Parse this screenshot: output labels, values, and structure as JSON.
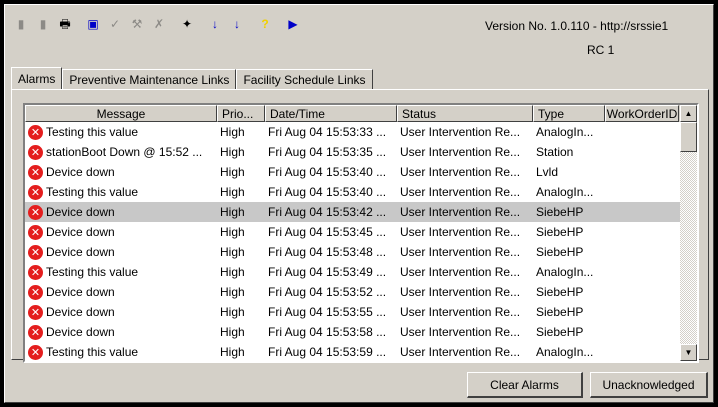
{
  "toolbar": {
    "buttons": [
      {
        "name": "lock-icon",
        "glyph": "▮"
      },
      {
        "name": "lock-icon-2",
        "glyph": "▮"
      },
      {
        "name": "print-icon",
        "glyph": "🖶"
      },
      {
        "name": "copy-icon",
        "glyph": "▣"
      },
      {
        "name": "check-icon",
        "glyph": "✓"
      },
      {
        "name": "acknowledge-icon",
        "glyph": "⚒"
      },
      {
        "name": "clear-icon",
        "glyph": "✗"
      },
      {
        "name": "filter-icon",
        "glyph": "✦"
      },
      {
        "name": "sort-ascending-icon",
        "glyph": "↓"
      },
      {
        "name": "sort-descending-icon",
        "glyph": "↓"
      },
      {
        "name": "help-icon",
        "glyph": "?"
      },
      {
        "name": "next-icon",
        "glyph": "▶"
      }
    ]
  },
  "version_text": "Version No. 1.0.110 - http://srssie1",
  "rc_text": "RC 1",
  "tabs": [
    "Alarms",
    "Preventive Maintenance Links",
    "Facility Schedule Links"
  ],
  "columns": [
    "Message",
    "Prio...",
    "Date/Time",
    "Status",
    "Type",
    "WorkOrderID"
  ],
  "rows": [
    {
      "message": "Testing this value",
      "priority": "High",
      "datetime": "Fri Aug 04 15:53:33 ...",
      "status": "User Intervention Re...",
      "type": "AnalogIn...",
      "workorder": ""
    },
    {
      "message": "stationBoot Down @ 15:52 ...",
      "priority": "High",
      "datetime": "Fri Aug 04 15:53:35 ...",
      "status": "User Intervention Re...",
      "type": "Station",
      "workorder": ""
    },
    {
      "message": "Device down",
      "priority": "High",
      "datetime": "Fri Aug 04 15:53:40 ...",
      "status": "User Intervention Re...",
      "type": "Lvld",
      "workorder": ""
    },
    {
      "message": "Testing this value",
      "priority": "High",
      "datetime": "Fri Aug 04 15:53:40 ...",
      "status": "User Intervention Re...",
      "type": "AnalogIn...",
      "workorder": ""
    },
    {
      "message": "Device down",
      "priority": "High",
      "datetime": "Fri Aug 04 15:53:42 ...",
      "status": "User Intervention Re...",
      "type": "SiebeHP",
      "workorder": "",
      "selected": true
    },
    {
      "message": "Device down",
      "priority": "High",
      "datetime": "Fri Aug 04 15:53:45 ...",
      "status": "User Intervention Re...",
      "type": "SiebeHP",
      "workorder": ""
    },
    {
      "message": "Device down",
      "priority": "High",
      "datetime": "Fri Aug 04 15:53:48 ...",
      "status": "User Intervention Re...",
      "type": "SiebeHP",
      "workorder": ""
    },
    {
      "message": "Testing this value",
      "priority": "High",
      "datetime": "Fri Aug 04 15:53:49 ...",
      "status": "User Intervention Re...",
      "type": "AnalogIn...",
      "workorder": ""
    },
    {
      "message": "Device down",
      "priority": "High",
      "datetime": "Fri Aug 04 15:53:52 ...",
      "status": "User Intervention Re...",
      "type": "SiebeHP",
      "workorder": ""
    },
    {
      "message": "Device down",
      "priority": "High",
      "datetime": "Fri Aug 04 15:53:55 ...",
      "status": "User Intervention Re...",
      "type": "SiebeHP",
      "workorder": ""
    },
    {
      "message": "Device down",
      "priority": "High",
      "datetime": "Fri Aug 04 15:53:58 ...",
      "status": "User Intervention Re...",
      "type": "SiebeHP",
      "workorder": ""
    },
    {
      "message": "Testing this value",
      "priority": "High",
      "datetime": "Fri Aug 04 15:53:59 ...",
      "status": "User Intervention Re...",
      "type": "AnalogIn...",
      "workorder": ""
    }
  ],
  "buttons": {
    "clear_alarms": "Clear Alarms",
    "unacknowledged": "Unacknowledged"
  },
  "colors": {
    "face": "#d4d0c8",
    "error_icon": "#e41e1e",
    "selected_row": "#c8c8c8",
    "toolbar_blue": "#0000c8",
    "toolbar_yellow": "#f0d000"
  }
}
